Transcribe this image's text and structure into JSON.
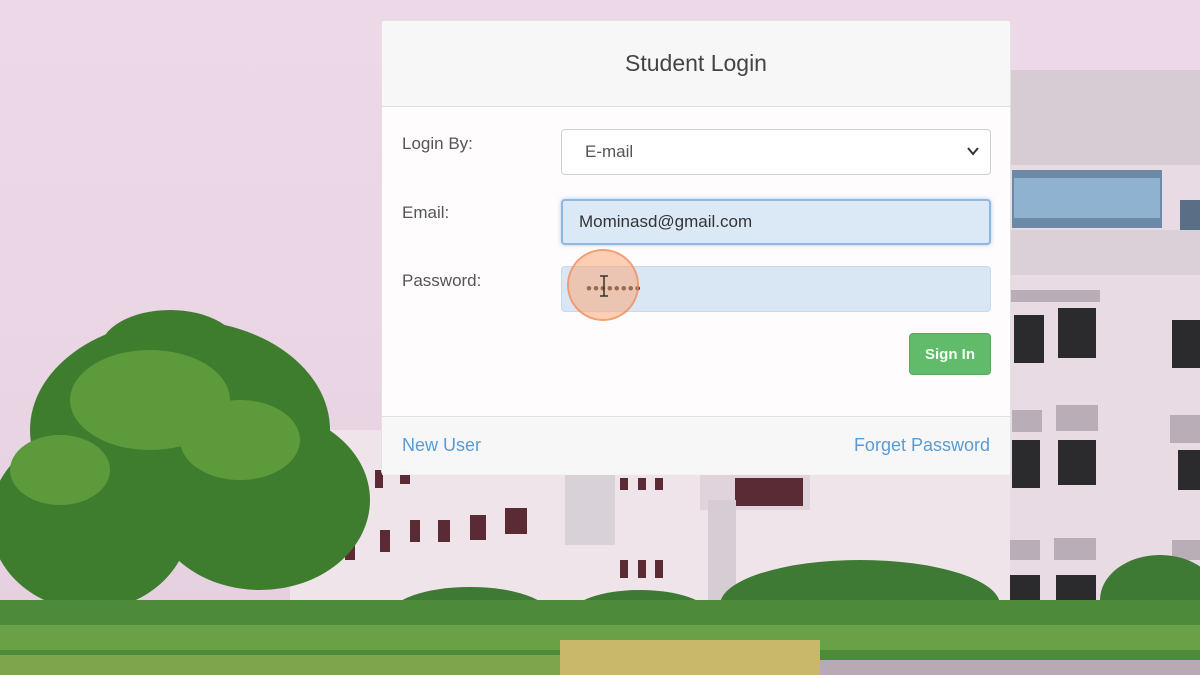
{
  "background": {
    "description_icon": "campus-building-image"
  },
  "login": {
    "title": "Student Login",
    "login_by_label": "Login By:",
    "login_by_value": "E-mail",
    "email_label": "Email:",
    "email_value": "Mominasd@gmail.com",
    "password_label": "Password:",
    "password_value": "••••••••",
    "signin_label": "Sign In",
    "new_user_label": "New User",
    "forget_password_label": "Forget Password"
  },
  "colors": {
    "accent_green": "#62bb6a",
    "link_blue": "#5b9bd3",
    "focus_blue": "#8fb7e0"
  },
  "icons": {
    "select_chevron": "chevron-down-icon",
    "cursor": "text-cursor-icon"
  }
}
